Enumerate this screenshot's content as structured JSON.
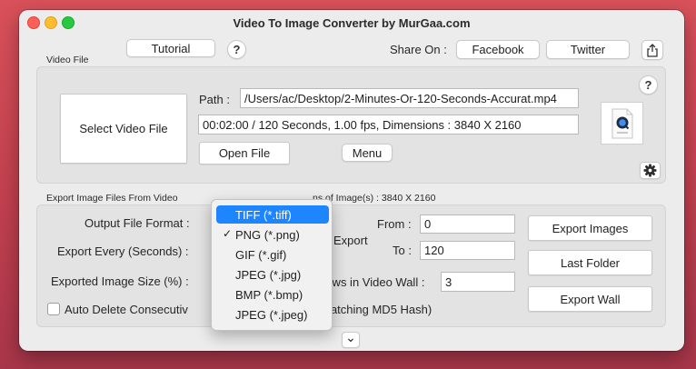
{
  "window": {
    "title": "Video To Image Converter by MurGaa.com"
  },
  "header": {
    "tutorial_label": "Tutorial",
    "help_glyph": "?",
    "share_label": "Share On :",
    "facebook_label": "Facebook",
    "twitter_label": "Twitter",
    "share_icon": "share-icon"
  },
  "video_file": {
    "section_label": "Video File",
    "select_button": "Select Video File",
    "path_label": "Path :",
    "path_value": "/Users/ac/Desktop/2-Minutes-Or-120-Seconds-Accurat.mp4",
    "info_value": "00:02:00 / 120 Seconds, 1.00 fps, Dimensions : 3840 X 2160",
    "open_file_button": "Open File",
    "menu_button": "Menu",
    "help_glyph": "?",
    "thumbnail_icon": "quicktime-file-icon",
    "settings_icon": "gear-icon"
  },
  "export": {
    "section_label_left": "Export Image Files From Video",
    "section_label_right": "ns of Image(s) : 3840 X 2160",
    "output_format_label": "Output File Format :",
    "export_every_label": "Export Every (Seconds) :",
    "image_size_label": "Exported Image Size (%) :",
    "export_label": "Export",
    "from_label": "From :",
    "from_value": "0",
    "to_label": "To :",
    "to_value": "120",
    "rows_label": "r Rows in Video Wall :",
    "rows_value": "3",
    "export_images_button": "Export Images",
    "last_folder_button": "Last Folder",
    "export_wall_button": "Export Wall",
    "auto_delete_label_left": "Auto Delete Consecutiv",
    "auto_delete_label_right": "y Matching MD5 Hash)",
    "expand_glyph": "⌄"
  },
  "format_dropdown": {
    "items": [
      {
        "label": "TIFF (*.tiff)",
        "highlighted": true,
        "checked": false
      },
      {
        "label": "PNG (*.png)",
        "highlighted": false,
        "checked": true
      },
      {
        "label": "GIF (*.gif)",
        "highlighted": false,
        "checked": false
      },
      {
        "label": "JPEG (*.jpg)",
        "highlighted": false,
        "checked": false
      },
      {
        "label": "BMP (*.bmp)",
        "highlighted": false,
        "checked": false
      },
      {
        "label": "JPEG (*.jpeg)",
        "highlighted": false,
        "checked": false
      }
    ],
    "check_glyph": "✓",
    "highlight_color": "#1d86ff"
  }
}
